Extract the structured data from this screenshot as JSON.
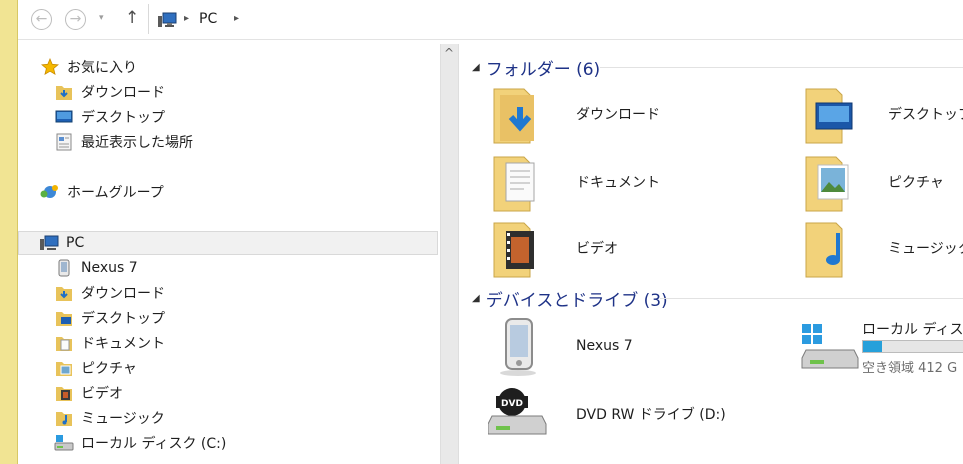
{
  "address": {
    "nav_back": "←",
    "nav_forward": "→",
    "nav_recent": "▾",
    "nav_up": "↑",
    "separator": "▸",
    "crumb": "PC"
  },
  "sidebar": {
    "favorites": {
      "label": "お気に入り",
      "items": [
        {
          "label": "ダウンロード",
          "icon": "download-folder-icon"
        },
        {
          "label": "デスクトップ",
          "icon": "desktop-icon"
        },
        {
          "label": "最近表示した場所",
          "icon": "recent-places-icon"
        }
      ]
    },
    "homegroup": {
      "label": "ホームグループ"
    },
    "pc": {
      "label": "PC",
      "items": [
        {
          "label": "Nexus 7",
          "icon": "phone-icon"
        },
        {
          "label": "ダウンロード",
          "icon": "download-folder-icon"
        },
        {
          "label": "デスクトップ",
          "icon": "desktop-folder-icon"
        },
        {
          "label": "ドキュメント",
          "icon": "documents-icon"
        },
        {
          "label": "ピクチャ",
          "icon": "pictures-icon"
        },
        {
          "label": "ビデオ",
          "icon": "videos-icon"
        },
        {
          "label": "ミュージック",
          "icon": "music-icon"
        },
        {
          "label": "ローカル ディスク (C:)",
          "icon": "local-disk-icon"
        }
      ]
    }
  },
  "scroll": {
    "up": "^"
  },
  "main": {
    "folders": {
      "toggle": "◢",
      "title": "フォルダー (6)",
      "items": [
        {
          "label": "ダウンロード",
          "icon": "download-folder-icon"
        },
        {
          "label": "デスクトップ",
          "icon": "desktop-folder-icon"
        },
        {
          "label": "ドキュメント",
          "icon": "documents-folder-icon"
        },
        {
          "label": "ピクチャ",
          "icon": "pictures-folder-icon"
        },
        {
          "label": "ビデオ",
          "icon": "videos-folder-icon"
        },
        {
          "label": "ミュージック",
          "icon": "music-folder-icon"
        }
      ]
    },
    "devices": {
      "toggle": "◢",
      "title": "デバイスとドライブ (3)",
      "items": [
        {
          "label": "Nexus 7",
          "icon": "phone-device-icon"
        },
        {
          "label": "ローカル ディスク (",
          "icon": "windows-drive-icon",
          "free_text": "空き領域 412 G",
          "used_fraction": 0.18
        },
        {
          "label": "DVD RW ドライブ (D:)",
          "icon": "dvd-drive-icon"
        }
      ]
    }
  },
  "colors": {
    "accent": "#f1e493",
    "group_title": "#1e3287",
    "drive_bar": "#26a0da"
  }
}
